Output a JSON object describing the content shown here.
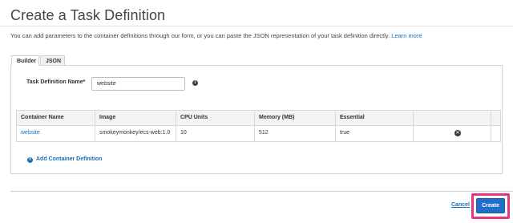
{
  "header": {
    "title": "Create a Task Definition",
    "intro_text": "You can add parameters to the container definitions through our form, or you can paste the JSON representation of your task definition directly.",
    "learn_more": "Learn more"
  },
  "tabs": [
    {
      "label": "Builder",
      "active": true
    },
    {
      "label": "JSON",
      "active": false
    }
  ],
  "form": {
    "name_label": "Task Definition Name*",
    "name_value": "website",
    "info_icon": "info-icon"
  },
  "table": {
    "columns": [
      "Container Name",
      "Image",
      "CPU Units",
      "Memory (MB)",
      "Essential",
      ""
    ],
    "rows": [
      {
        "container_name": "website",
        "image": "smokeymonkey/ecs-web:1.0",
        "cpu_units": "10",
        "memory": "512",
        "essential": "true",
        "remove_icon": "remove-circle-icon"
      }
    ]
  },
  "add_container": {
    "label": "Add Container Definition",
    "icon": "plus-circle-icon"
  },
  "footer": {
    "cancel_label": "Cancel",
    "create_label": "Create",
    "highlight_color": "#e6377d"
  },
  "colors": {
    "link": "#1a6fb8",
    "primary_button": "#1f6fc9"
  }
}
